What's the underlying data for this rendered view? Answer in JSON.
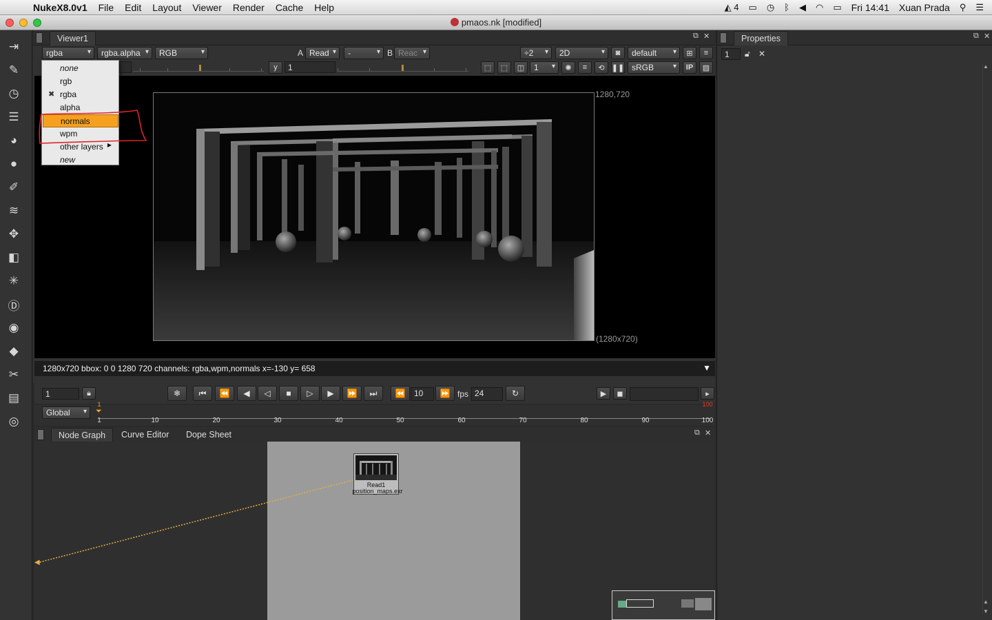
{
  "menubar": {
    "app_name": "NukeX8.0v1",
    "items": [
      "File",
      "Edit",
      "Layout",
      "Viewer",
      "Render",
      "Cache",
      "Help"
    ],
    "status_text": "4",
    "clock": "Fri 14:41",
    "user": "Xuan Prada"
  },
  "window": {
    "title": "pmaos.nk [modified]"
  },
  "viewer": {
    "tab": "Viewer1",
    "channels": "rgba",
    "alpha_channel": "rgba.alpha",
    "display": "RGB",
    "input_a_label": "A",
    "input_a": "Read",
    "wipe": "-",
    "input_b_label": "B",
    "input_b": "Reac",
    "downrez": "÷2",
    "view_mode": "2D",
    "lut_default": "default",
    "gamma_label": "y",
    "gamma_value": "1",
    "roi_value": "1",
    "colorspace": "sRGB",
    "ip": "IP",
    "frame_tr": "1280,720",
    "frame_br": "(1280x720)"
  },
  "channel_menu": {
    "items": [
      {
        "label": "none",
        "italic": true
      },
      {
        "label": "rgb"
      },
      {
        "label": "rgba",
        "checked": true
      },
      {
        "label": "alpha"
      },
      {
        "label": "normals",
        "selected": true
      },
      {
        "label": "wpm"
      },
      {
        "label": "other layers",
        "submenu": true
      },
      {
        "label": "new",
        "italic": true
      }
    ]
  },
  "infobar": {
    "text": "1280x720 bbox: 0 0 1280 720 channels: rgba,wpm,normals    x=-130 y= 658"
  },
  "playback": {
    "frame": "1",
    "step": "10",
    "fps_label": "fps",
    "fps": "24"
  },
  "timeline": {
    "scope": "Global",
    "ticks": [
      "1",
      "10",
      "20",
      "30",
      "40",
      "50",
      "60",
      "70",
      "80",
      "90",
      "100"
    ],
    "current_marker": "1",
    "end_marker": "100"
  },
  "nodegraph": {
    "tabs": [
      "Node Graph",
      "Curve Editor",
      "Dope Sheet"
    ],
    "node_name": "Read1",
    "node_file": "position_maps.exr"
  },
  "properties": {
    "tab": "Properties",
    "max_panels": "1"
  },
  "colors": {
    "accent_orange": "#f6a020",
    "panel_bg": "#323232",
    "annotation_red": "#e0242a"
  }
}
